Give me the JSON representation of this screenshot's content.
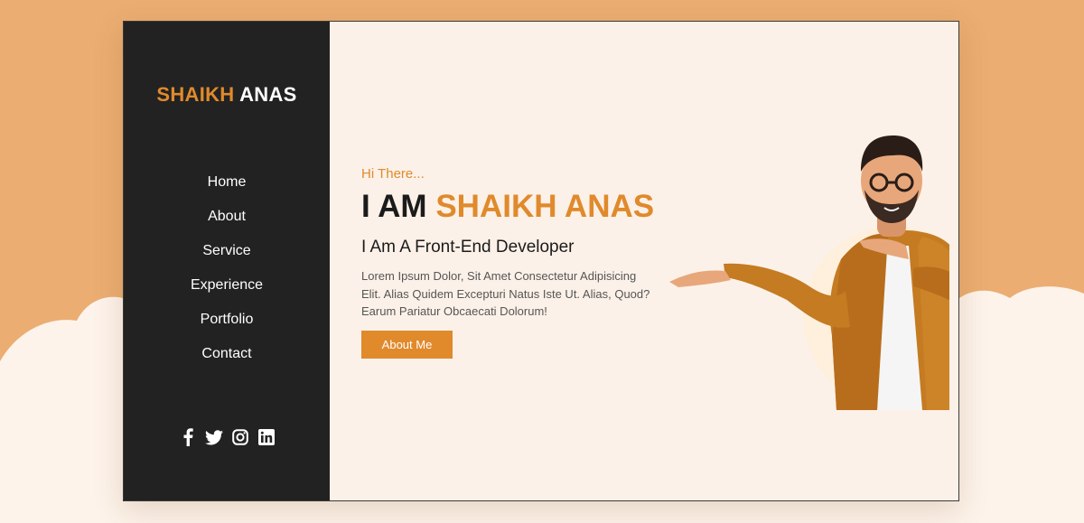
{
  "brand": {
    "first": "SHAIKH",
    "last": "ANAS"
  },
  "nav": [
    {
      "label": "Home"
    },
    {
      "label": "About"
    },
    {
      "label": "Service"
    },
    {
      "label": "Experience"
    },
    {
      "label": "Portfolio"
    },
    {
      "label": "Contact"
    }
  ],
  "social": [
    "facebook-icon",
    "twitter-icon",
    "instagram-icon",
    "linkedin-icon"
  ],
  "hero": {
    "greeting": "Hi There...",
    "headline_prefix": "I AM",
    "headline_name": "SHAIKH ANAS",
    "subtitle": "I Am A Front-End Developer",
    "description": "Lorem Ipsum Dolor, Sit Amet Consectetur Adipisicing Elit. Alias Quidem Excepturi Natus Iste Ut. Alias, Quod? Earum Pariatur Obcaecati Dolorum!",
    "button_label": "About Me"
  },
  "colors": {
    "accent": "#e08a2c",
    "sidebar": "#222222",
    "page_background": "#ebad72",
    "content_background": "#fcf1e8"
  }
}
